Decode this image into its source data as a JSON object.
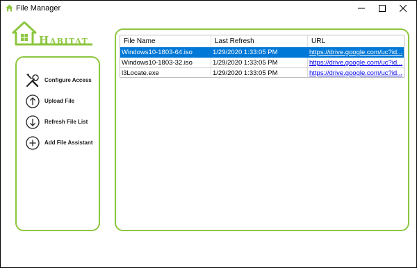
{
  "window": {
    "title": "File Manager"
  },
  "logo": {
    "text_first": "H",
    "text_rest": "ABITAT",
    "accent_color": "#8cc63f"
  },
  "sidebar": {
    "items": [
      {
        "label": "Configure Access",
        "icon": "wrench-screwdriver-icon"
      },
      {
        "label": "Upload File",
        "icon": "arrow-up-circle-icon"
      },
      {
        "label": "Refresh File List",
        "icon": "arrow-down-circle-icon"
      },
      {
        "label": "Add File Assistant",
        "icon": "plus-circle-icon"
      }
    ]
  },
  "grid": {
    "columns": [
      "File Name",
      "Last Refresh",
      "URL"
    ],
    "rows": [
      {
        "file_name": "Windows10-1803-64.iso",
        "last_refresh": "1/29/2020 1:33:05 PM",
        "url": "https://drive.google.com/uc?id...",
        "selected": true
      },
      {
        "file_name": "Windows10-1803-32.iso",
        "last_refresh": "1/29/2020 1:33:05 PM",
        "url": "https://drive.google.com/uc?id...",
        "selected": false
      },
      {
        "file_name": "l3Locate.exe",
        "last_refresh": "1/29/2020 1:33:05 PM",
        "url": "https://drive.google.com/uc?id...",
        "selected": false
      }
    ],
    "selection_color": "#0078d7"
  }
}
